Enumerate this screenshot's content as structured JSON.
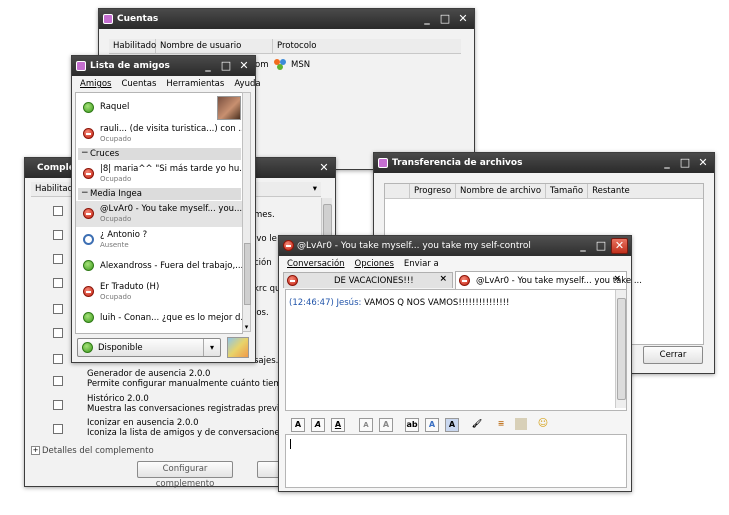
{
  "accounts_window": {
    "title": "Cuentas",
    "columns": [
      "Habilitado",
      "Nombre de usuario",
      "Protocolo"
    ],
    "row_username_fragment": "om",
    "row_protocol": "MSN"
  },
  "plugins_window": {
    "title": "Comple",
    "column_habilitado": "Habilitado",
    "row_fragments": [
      "mes.",
      "ivo le",
      "ción",
      "krc qu",
      "jos."
    ],
    "rows": [
      {
        "fragment": "sajes."
      },
      {
        "name": "Generador de ausencia 2.0.0",
        "desc": "Permite configurar manualmente cuánto tiempo ha estado"
      },
      {
        "name": "Histórico 2.0.0",
        "desc": "Muestra las conversaciones registradas previamente en la"
      },
      {
        "name": "Iconizar en ausencia 2.0.0",
        "desc": "Iconiza la lista de amigos y de conversaciones cuando us"
      }
    ],
    "details_label": "Detalles del complemento",
    "configure_button": "Configurar complemento",
    "close_button_fragment": "C"
  },
  "buddy_window": {
    "title": "Lista de amigos",
    "menu": [
      "Amigos",
      "Cuentas",
      "Herramientas",
      "Ayuda"
    ],
    "contacts_top": [
      {
        "name": "Raquel",
        "status": "online"
      },
      {
        "name": "rauli... (de visita turistica...) con ...",
        "sub": "Ocupado",
        "status": "busy"
      }
    ],
    "group_cruces": "Cruces",
    "contacts_cruces": [
      {
        "name": "|8| maria^^   \"Si más tarde yo hu...",
        "sub": "Ocupado",
        "status": "busy"
      }
    ],
    "group_media": "Media Ingea",
    "contacts_media": [
      {
        "name": "@LvAr0 - You take myself... you...",
        "sub": "Ocupado",
        "status": "busy"
      },
      {
        "name": "¿ Antonio ?",
        "sub": "Ausente",
        "status": "away"
      },
      {
        "name": "Alexandross - Fuera del trabajo,...",
        "status": "online"
      },
      {
        "name": "Er Traduto (H)",
        "sub": "Ocupado",
        "status": "busy"
      },
      {
        "name": "luih - Conan... ¿que es lo mejor d...",
        "status": "online"
      }
    ],
    "status_selector": "Disponible"
  },
  "transfer_window": {
    "title": "Transferencia de archivos",
    "columns": [
      "Progreso",
      "Nombre de archivo",
      "Tamaño",
      "Restante"
    ],
    "close_button": "Cerrar"
  },
  "chat_window": {
    "title": "@LvAr0 - You take myself... you take my self-control",
    "menu": [
      "Conversación",
      "Opciones",
      "Enviar a"
    ],
    "tabs": [
      {
        "label": "DE VACACIONES!!!"
      },
      {
        "label": "@LvAr0 - You take myself... you take ..."
      }
    ],
    "message": {
      "time": "(12:46:47)",
      "sender": "Jesús:",
      "text": "VAMOS Q NOS VAMOS!!!!!!!!!!!!!!!"
    },
    "toolbar": [
      "A",
      "A",
      "A",
      "A",
      "A",
      "ab",
      "A",
      "A"
    ]
  }
}
